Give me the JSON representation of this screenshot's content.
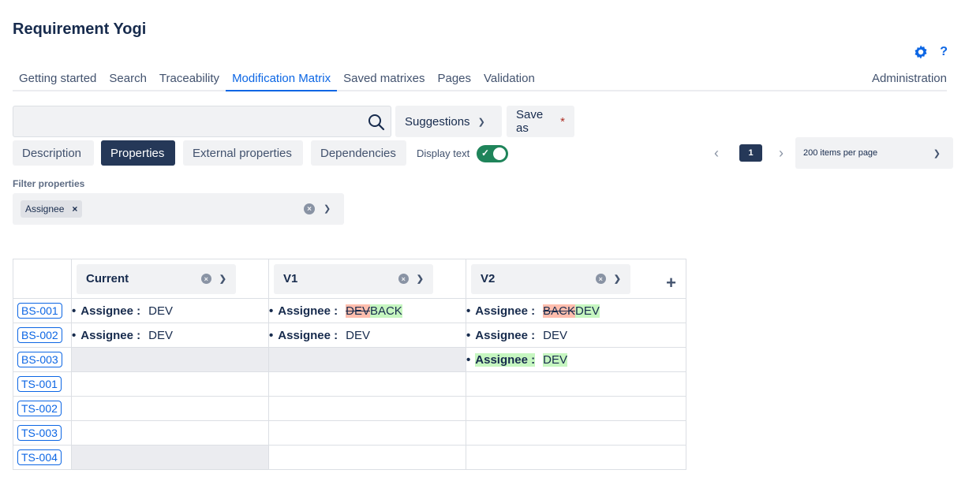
{
  "app": {
    "title": "Requirement Yogi"
  },
  "header_icons": {
    "settings_icon": "gear-icon",
    "help_label": "?"
  },
  "tabs": [
    {
      "label": "Getting started",
      "active": false
    },
    {
      "label": "Search",
      "active": false
    },
    {
      "label": "Traceability",
      "active": false
    },
    {
      "label": "Modification Matrix",
      "active": true
    },
    {
      "label": "Saved matrixes",
      "active": false
    },
    {
      "label": "Pages",
      "active": false
    },
    {
      "label": "Validation",
      "active": false
    }
  ],
  "admin_label": "Administration",
  "search": {
    "value": "",
    "placeholder": ""
  },
  "toolbar": {
    "suggestions_label": "Suggestions",
    "save_as_label": "Save as",
    "save_as_marker": "*"
  },
  "views": [
    {
      "label": "Description",
      "active": false
    },
    {
      "label": "Properties",
      "active": true
    },
    {
      "label": "External properties",
      "active": false
    },
    {
      "label": "Dependencies",
      "active": false
    }
  ],
  "display_text": {
    "label": "Display text",
    "enabled": true
  },
  "pagination": {
    "current_page": "1",
    "per_page": "200 items per page"
  },
  "filter": {
    "label": "Filter properties",
    "chips": [
      "Assignee"
    ]
  },
  "matrix": {
    "columns": [
      "Current",
      "V1",
      "V2"
    ],
    "rows": [
      {
        "id": "BS-001",
        "cells": [
          {
            "empty": false,
            "gray": false,
            "prop": "Assignee :",
            "value": "DEV"
          },
          {
            "empty": false,
            "gray": false,
            "prop": "Assignee :",
            "removed": "DEV",
            "added": "BACK"
          },
          {
            "empty": false,
            "gray": false,
            "prop": "Assignee :",
            "removed": "BACK",
            "added": "DEV"
          }
        ]
      },
      {
        "id": "BS-002",
        "cells": [
          {
            "empty": false,
            "gray": false,
            "prop": "Assignee :",
            "value": "DEV"
          },
          {
            "empty": false,
            "gray": false,
            "prop": "Assignee :",
            "value": "DEV"
          },
          {
            "empty": false,
            "gray": false,
            "prop": "Assignee :",
            "value": "DEV"
          }
        ]
      },
      {
        "id": "BS-003",
        "cells": [
          {
            "empty": true,
            "gray": true
          },
          {
            "empty": true,
            "gray": true
          },
          {
            "empty": false,
            "gray": false,
            "prop": "Assignee :",
            "value": "DEV",
            "new": true
          }
        ]
      },
      {
        "id": "TS-001",
        "cells": [
          {
            "empty": true
          },
          {
            "empty": true
          },
          {
            "empty": true
          }
        ]
      },
      {
        "id": "TS-002",
        "cells": [
          {
            "empty": true
          },
          {
            "empty": true
          },
          {
            "empty": true
          }
        ]
      },
      {
        "id": "TS-003",
        "cells": [
          {
            "empty": true
          },
          {
            "empty": true
          },
          {
            "empty": true
          }
        ]
      },
      {
        "id": "TS-004",
        "cells": [
          {
            "empty": true,
            "gray": true
          },
          {
            "empty": true
          },
          {
            "empty": true
          }
        ]
      }
    ]
  },
  "colors": {
    "accent": "#0c66e4",
    "dark_button": "#253858",
    "toggle_on": "#1f845a",
    "removed_bg": "#ffbdad",
    "added_bg": "#c6f6c0"
  }
}
